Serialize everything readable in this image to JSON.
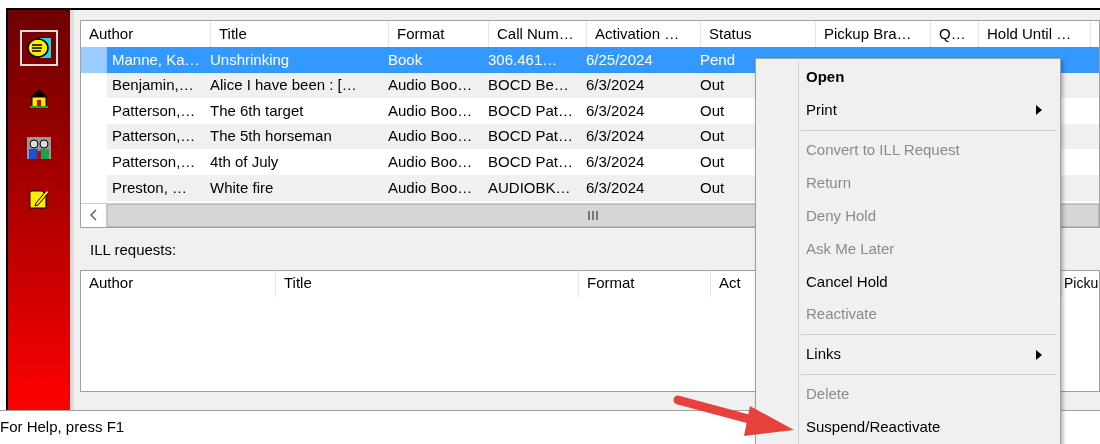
{
  "sidebar": {
    "items": [
      {
        "selected": true
      },
      {
        "selected": false
      },
      {
        "selected": false
      },
      {
        "selected": false
      }
    ]
  },
  "holds_table": {
    "columns": [
      "Author",
      "Title",
      "Format",
      "Call Num…",
      "Activation …",
      "Status",
      "Pickup Bra…",
      "Q…",
      "Hold Until …"
    ],
    "rows": [
      {
        "selected": true,
        "cells": [
          "Manne, Ka…",
          "Unshrinking",
          "Book",
          "306.461…",
          "6/25/2024",
          "Pend"
        ]
      },
      {
        "selected": false,
        "cells": [
          "Benjamin,…",
          "Alice I have been : […",
          "Audio Boo…",
          "BOCD Be…",
          "6/3/2024",
          "Out"
        ]
      },
      {
        "selected": false,
        "cells": [
          "Patterson,…",
          "The 6th target",
          "Audio Boo…",
          "BOCD Pat…",
          "6/3/2024",
          "Out"
        ]
      },
      {
        "selected": false,
        "cells": [
          "Patterson,…",
          "The 5th horseman",
          "Audio Boo…",
          "BOCD Pat…",
          "6/3/2024",
          "Out"
        ]
      },
      {
        "selected": false,
        "cells": [
          "Patterson,…",
          "4th of July",
          "Audio Boo…",
          "BOCD Pat…",
          "6/3/2024",
          "Out"
        ]
      },
      {
        "selected": false,
        "cells": [
          "Preston, …",
          "White fire",
          "Audio Boo…",
          "AUDIOBK…",
          "6/3/2024",
          "Out"
        ]
      }
    ]
  },
  "ill_label": "ILL requests:",
  "ill_table": {
    "columns": [
      "Author",
      "Title",
      "Format",
      "Act",
      "Picku"
    ]
  },
  "context_menu": [
    {
      "kind": "item",
      "label": "Open",
      "default": true,
      "disabled": false,
      "submenu": false
    },
    {
      "kind": "item",
      "label": "Print",
      "default": false,
      "disabled": false,
      "submenu": true
    },
    {
      "kind": "separator"
    },
    {
      "kind": "item",
      "label": "Convert to ILL Request",
      "default": false,
      "disabled": true,
      "submenu": false
    },
    {
      "kind": "item",
      "label": "Return",
      "default": false,
      "disabled": true,
      "submenu": false
    },
    {
      "kind": "item",
      "label": "Deny Hold",
      "default": false,
      "disabled": true,
      "submenu": false
    },
    {
      "kind": "item",
      "label": "Ask Me Later",
      "default": false,
      "disabled": true,
      "submenu": false
    },
    {
      "kind": "item",
      "label": "Cancel Hold",
      "default": false,
      "disabled": false,
      "submenu": false
    },
    {
      "kind": "item",
      "label": "Reactivate",
      "default": false,
      "disabled": true,
      "submenu": false
    },
    {
      "kind": "separator"
    },
    {
      "kind": "item",
      "label": "Links",
      "default": false,
      "disabled": false,
      "submenu": true
    },
    {
      "kind": "separator"
    },
    {
      "kind": "item",
      "label": "Delete",
      "default": false,
      "disabled": true,
      "submenu": false
    },
    {
      "kind": "item",
      "label": "Suspend/Reactivate",
      "default": false,
      "disabled": false,
      "submenu": false
    }
  ],
  "status_bar": "For Help, press F1"
}
